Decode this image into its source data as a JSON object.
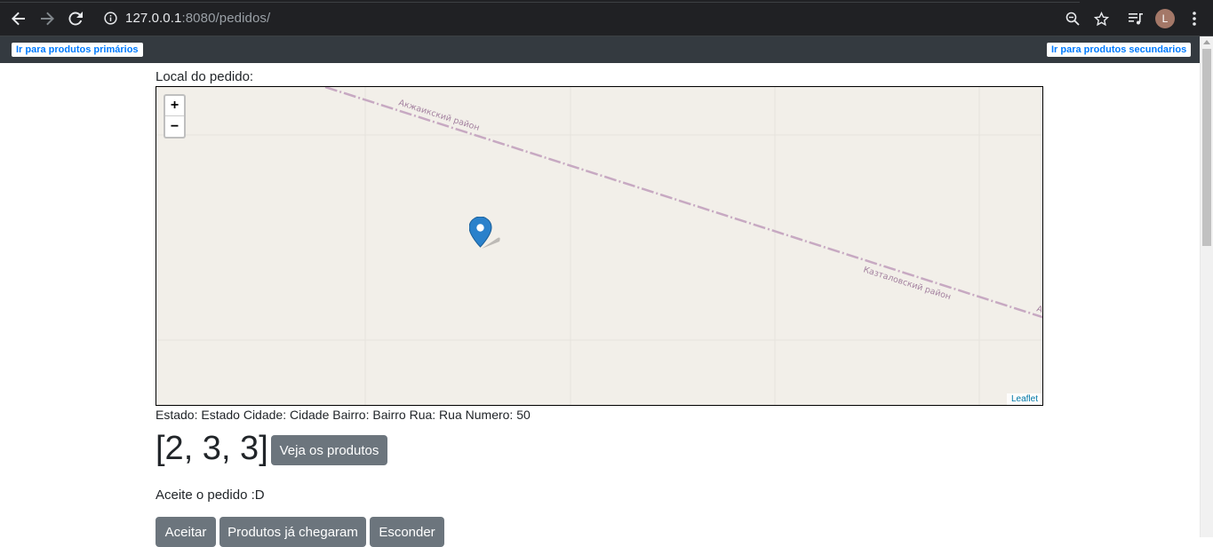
{
  "browser": {
    "url_host": "127.0.0.1",
    "url_rest": ":8080/pedidos/",
    "profile_initial": "L"
  },
  "appbar": {
    "primary_link": "Ir para produtos primários",
    "secondary_link": "Ir para produtos secundarios"
  },
  "map": {
    "label": "Local do pedido:",
    "zoom_in": "+",
    "zoom_out": "−",
    "attribution": "Leaflet",
    "district_top": "Акжаикский район",
    "district_right": "Казталовский район",
    "district_edge": "А"
  },
  "order": {
    "address": "Estado: Estado Cidade: Cidade Bairro: Bairro Rua: Rua Numero: 50",
    "coords": "[2, 3, 3]",
    "view_products": "Veja os produtos",
    "accept_text": "Aceite o pedido :D",
    "accept_button": "Aceitar",
    "arrived_button": "Produtos já chegaram",
    "hide_button": "Esconder"
  }
}
